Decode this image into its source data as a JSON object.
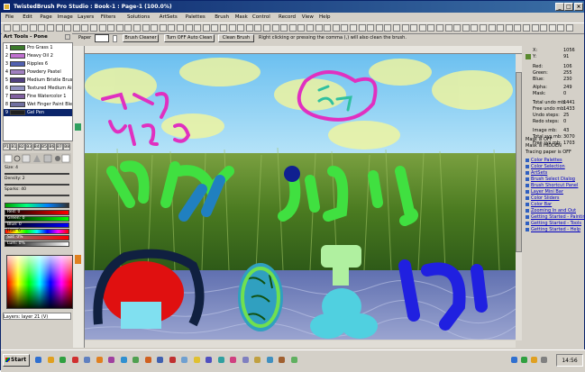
{
  "window": {
    "title": "TwistedBrush Pro Studio : Book-1 : Page-1 (100.0%)"
  },
  "menu": [
    "File",
    "Edit",
    "Page",
    "Image",
    "Layers",
    "Filters",
    "Solutions",
    "ArtSets",
    "Palettes",
    "Brush",
    "Mask",
    "Control",
    "Record",
    "View",
    "Help"
  ],
  "art_tools": {
    "label": "Art Tools - Pone"
  },
  "brushes": [
    {
      "num": "1",
      "name": "Pro Grass 1",
      "color": "#3a7a2a"
    },
    {
      "num": "2",
      "name": "Heavy Oil 2",
      "color": "#c070d0"
    },
    {
      "num": "3",
      "name": "Ripples 6",
      "color": "#5060b0"
    },
    {
      "num": "4",
      "name": "Powdery Pastel",
      "color": "#a080c0"
    },
    {
      "num": "5",
      "name": "Medium Bristle Brush",
      "color": "#504080"
    },
    {
      "num": "6",
      "name": "Textured Medium Air",
      "color": "#9090c0"
    },
    {
      "num": "7",
      "name": "Fine Watercolor 1",
      "color": "#8060a0"
    },
    {
      "num": "8",
      "name": "Wet Finger Paint Ble",
      "color": "#7070a0"
    },
    {
      "num": "9",
      "name": "Gel Pen",
      "color": "#202020"
    }
  ],
  "brush_pages": [
    "P1",
    "B1",
    "B2",
    "B3",
    "B4",
    "B5",
    "B6",
    "B7",
    "B8"
  ],
  "sliders": {
    "size": "Size: 4",
    "density": "Density: 2",
    "sparks": "Sparks: 40"
  },
  "color_values": {
    "red": "Red: 0",
    "green": "Green: 0",
    "blue": "Blue: 0",
    "hue": "Hue: 0",
    "sat": "Sat: 0%",
    "lum": "Lum: 0%"
  },
  "layers": {
    "label": "Layers: layer 21 (V)"
  },
  "options": {
    "paper_label": "Paper",
    "brush_cleaner": "Brush Cleaner",
    "auto_clean": "Turn OFF Auto Clean",
    "clean_brush": "Clean Brush",
    "hint": "Right clicking or pressing the comma (,) will also clean the brush."
  },
  "info": [
    {
      "k": "X:",
      "v": "1056"
    },
    {
      "k": "Y:",
      "v": "91"
    },
    {
      "k": "Red:",
      "v": "106"
    },
    {
      "k": "Green:",
      "v": "255"
    },
    {
      "k": "Blue:",
      "v": "230"
    },
    {
      "k": "Alpha:",
      "v": "249"
    },
    {
      "k": "Mask:",
      "v": "0"
    },
    {
      "k": "Total undo mb:",
      "v": "1441"
    },
    {
      "k": "Free undo mb:",
      "v": "1433"
    },
    {
      "k": "Undo steps:",
      "v": "25"
    },
    {
      "k": "Redo steps:",
      "v": "0"
    },
    {
      "k": "Image mb:",
      "v": "43"
    },
    {
      "k": "Total sys mb:",
      "v": "3070"
    },
    {
      "k": "Free sys mb:",
      "v": "1703"
    }
  ],
  "status": {
    "mask": "Mask is OFF",
    "mask_hidden": "Mask is HIDDEN",
    "tracing": "Tracing paper is OFF"
  },
  "help_links": [
    "Color Palettes",
    "Color Selection",
    "ArtSets",
    "Brush Select Dialog",
    "Brush Shortcut Panel",
    "Layer Mini Bar",
    "Color Sliders",
    "Color Bar",
    "Zooming In and Out",
    "Getting Started - Paintin",
    "Getting Started - Tools",
    "Getting Started - Help"
  ],
  "taskbar": {
    "start": "Start",
    "clock": "14:56"
  }
}
